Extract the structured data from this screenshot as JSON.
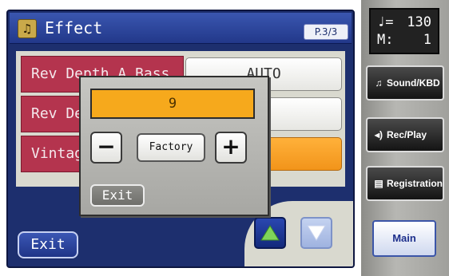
{
  "screen": {
    "title": "Effect",
    "title_icon": "music-note-icon",
    "page_indicator": "P.3/3",
    "exit_label": "Exit"
  },
  "params": [
    {
      "label": "Rev Depth A.Bass",
      "value": "AUTO"
    },
    {
      "label": "Rev Depth",
      "value": ""
    },
    {
      "label": "Vintage",
      "value": ""
    }
  ],
  "popup": {
    "value": "9",
    "decrement_label": "−",
    "factory_label": "Factory",
    "increment_label": "+",
    "exit_label": "Exit"
  },
  "side": {
    "tempo_symbol": "♩=",
    "tempo_value": "130",
    "measure_label": "M:",
    "measure_value": "1",
    "sound_kbd": "Sound/KBD",
    "rec_play": "Rec/Play",
    "registration": "Registration",
    "main": "Main"
  },
  "colors": {
    "screen_bg": "#1d2f6e",
    "label_bg": "#b4344e",
    "selected": "#f2941a",
    "popup_value": "#f6a91c"
  }
}
